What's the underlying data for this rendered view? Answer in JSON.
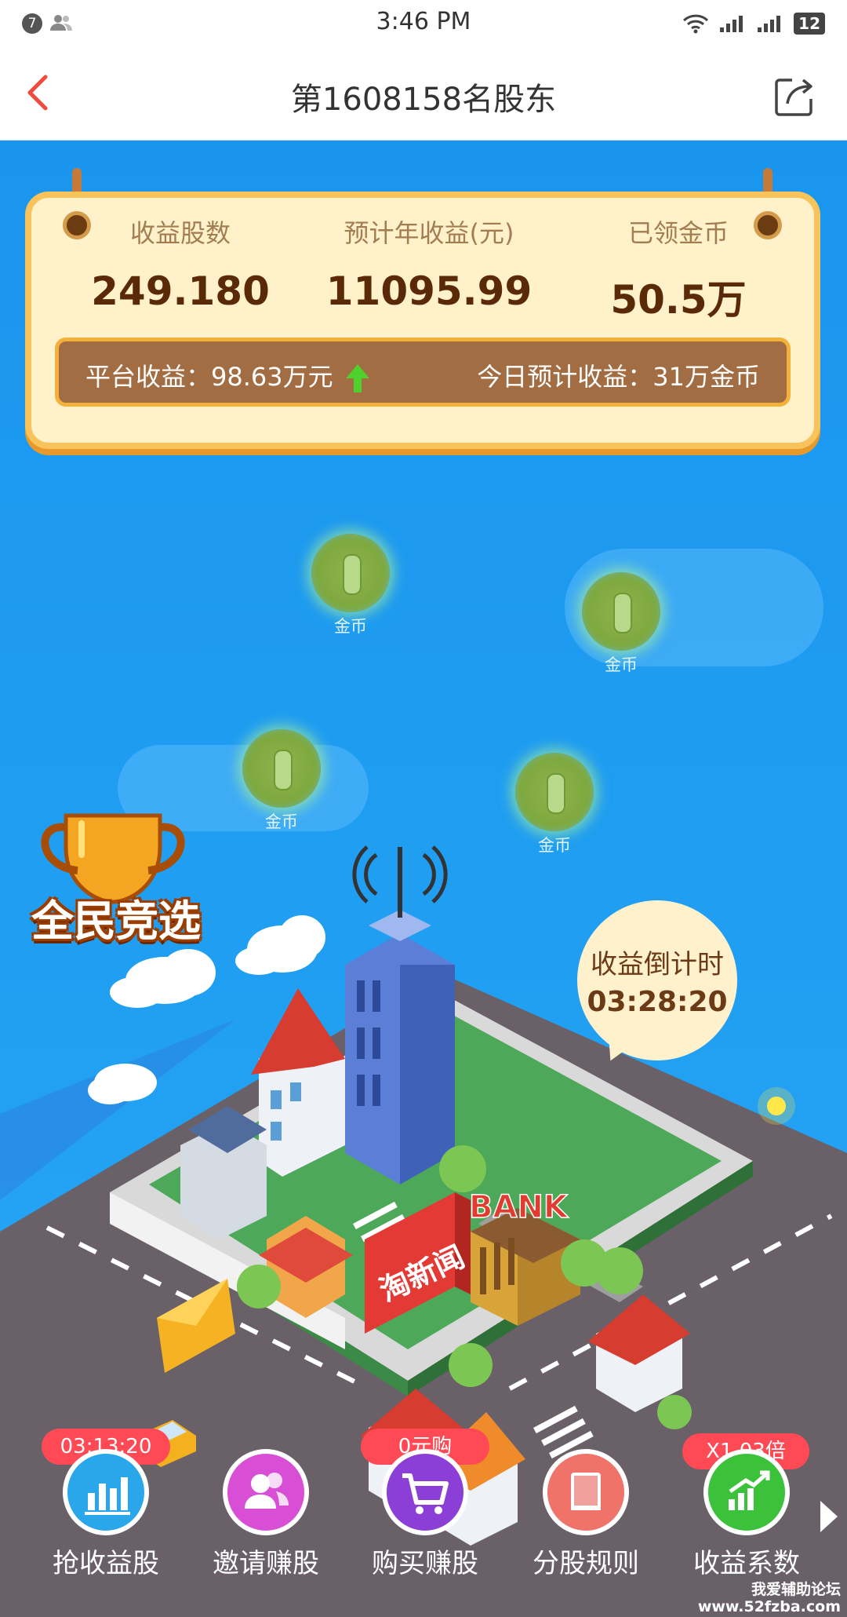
{
  "status_bar": {
    "notification_count": "7",
    "time": "3:46 PM",
    "battery": "12"
  },
  "nav": {
    "title": "第1608158名股东"
  },
  "summary": {
    "stats": [
      {
        "label": "收益股数",
        "value": "249.180"
      },
      {
        "label": "预计年收益(元)",
        "value": "11095.99"
      },
      {
        "label": "已领金币",
        "value": "50.5万"
      }
    ],
    "platform_income": "平台收益：98.63万元",
    "today_estimate": "今日预计收益：31万金币"
  },
  "coins": [
    {
      "label": "金币"
    },
    {
      "label": "金币"
    },
    {
      "label": "金币"
    },
    {
      "label": "金币"
    }
  ],
  "trophy": {
    "text": "全民竞选"
  },
  "city": {
    "bank_sign": "BANK",
    "news_sign": "淘新闻"
  },
  "countdown": {
    "label": "收益倒计时",
    "time": "03:28:20"
  },
  "bottom_nav": [
    {
      "label": "抢收益股",
      "badge": "03:13:20",
      "icon": "bar-chart-icon",
      "color": "#2aa7ea"
    },
    {
      "label": "邀请赚股",
      "badge": "",
      "icon": "users-icon",
      "color": "#d84fd6"
    },
    {
      "label": "购买赚股",
      "badge": "0元购",
      "icon": "cart-icon",
      "color": "#8b3fd6"
    },
    {
      "label": "分股规则",
      "badge": "",
      "icon": "book-icon",
      "color": "#f0736a"
    },
    {
      "label": "收益系数",
      "badge": "X1.03倍",
      "icon": "trend-up-icon",
      "color": "#3cc23a"
    }
  ],
  "watermark": {
    "line1": "我爱辅助论坛",
    "line2": "www.52fzba.com"
  }
}
